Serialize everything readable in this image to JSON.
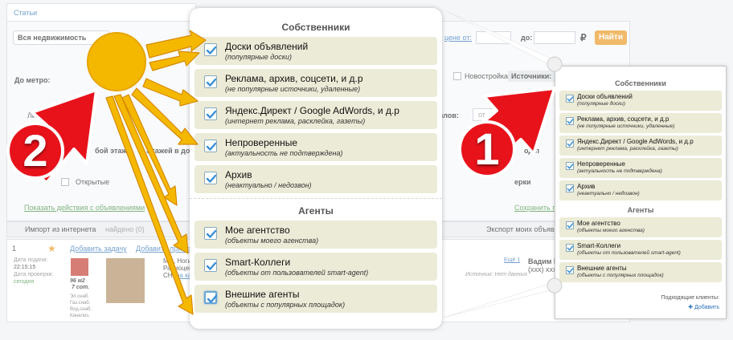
{
  "background": {
    "tab_label": "Статьи",
    "filters": {
      "property_type": "Вся недвижимость",
      "price_label": "цене от:",
      "to_label": "до:",
      "currency": "₽",
      "find_button": "Найти",
      "metro_label": "До метро:",
      "new_building_label": "Новостройка",
      "sources_label": "Источники:",
      "lift_label": "Лифт",
      "floor_label": "бой этаж",
      "floors_label": "Этажей в доме",
      "nodes_label": "узлов:",
      "from_label": "от",
      "open_label": "Открытые",
      "year_label": "од п",
      "sort_label": "ерки",
      "show_actions_link": "Показать действия с объявлениями",
      "save_link": "Сохранить по"
    },
    "strip": {
      "import_label": "Импорт из интернета",
      "found_label": "найдено (0)",
      "export_label": "Экспорт моих объявл"
    },
    "listing": {
      "index": "1",
      "add_task": "Добавить задачу",
      "add_note": "Добавить примеч",
      "date_added_label": "Дата подачи:",
      "date_added_time": "22:15:15",
      "date_checked_label": "Дата проверки:",
      "date_checked_value": "сегодня",
      "area": "96 м2",
      "price_per_day": "7 сот.",
      "utility1": "Эл.снаб.",
      "utility2": "Газ.снаб.",
      "utility3": "Вод.снаб.",
      "utility4": "Канализ.",
      "address1": "МО, Ногинск",
      "address2": "Радиоцентр",
      "address3": "СНТ",
      "address_link": "на карт",
      "source_label": "Источник: Нет данных",
      "more_link": "Ещё 1",
      "contact_name": "Вадим К",
      "contact_phone": "(ххх) ххх",
      "clients_label": "Подходящие клиенты:",
      "clients_add": "Добавить"
    }
  },
  "popup": {
    "owners_title": "Собственники",
    "agents_title": "Агенты",
    "owners": [
      {
        "label": "Доски объявлений",
        "desc": "(популярные доски)",
        "checked": true
      },
      {
        "label": "Реклама, архив, соцсети, и д.р",
        "desc": "(не популярные источники, удаленные)",
        "checked": true
      },
      {
        "label": "Яндекс.Директ / Google AdWords, и д.р",
        "desc": "(интернет реклама, расклейка, газеты)",
        "checked": true
      },
      {
        "label": "Непроверенные",
        "desc": "(актуальность не подтверждена)",
        "checked": true
      },
      {
        "label": "Архив",
        "desc": "(неактуально / недозвон)",
        "checked": true
      }
    ],
    "agents": [
      {
        "label": "Мое агентство",
        "desc": "(объекты моего агенства)",
        "checked": true
      },
      {
        "label": "Smart-Коллеги",
        "desc": "(объекты от пользователей smart-agent)",
        "checked": true
      },
      {
        "label": "Внешние агенты",
        "desc": "(объекты с популярных площадок)",
        "checked": true
      }
    ]
  },
  "annotations": {
    "marker_1": "1",
    "marker_2": "2",
    "arrow_color": "#e8121b",
    "sun_color": "#f5b800"
  },
  "colors": {
    "option_bg": "#ecebd7",
    "check_color": "#3b8fd6",
    "find_button_bg": "#e8961b"
  }
}
